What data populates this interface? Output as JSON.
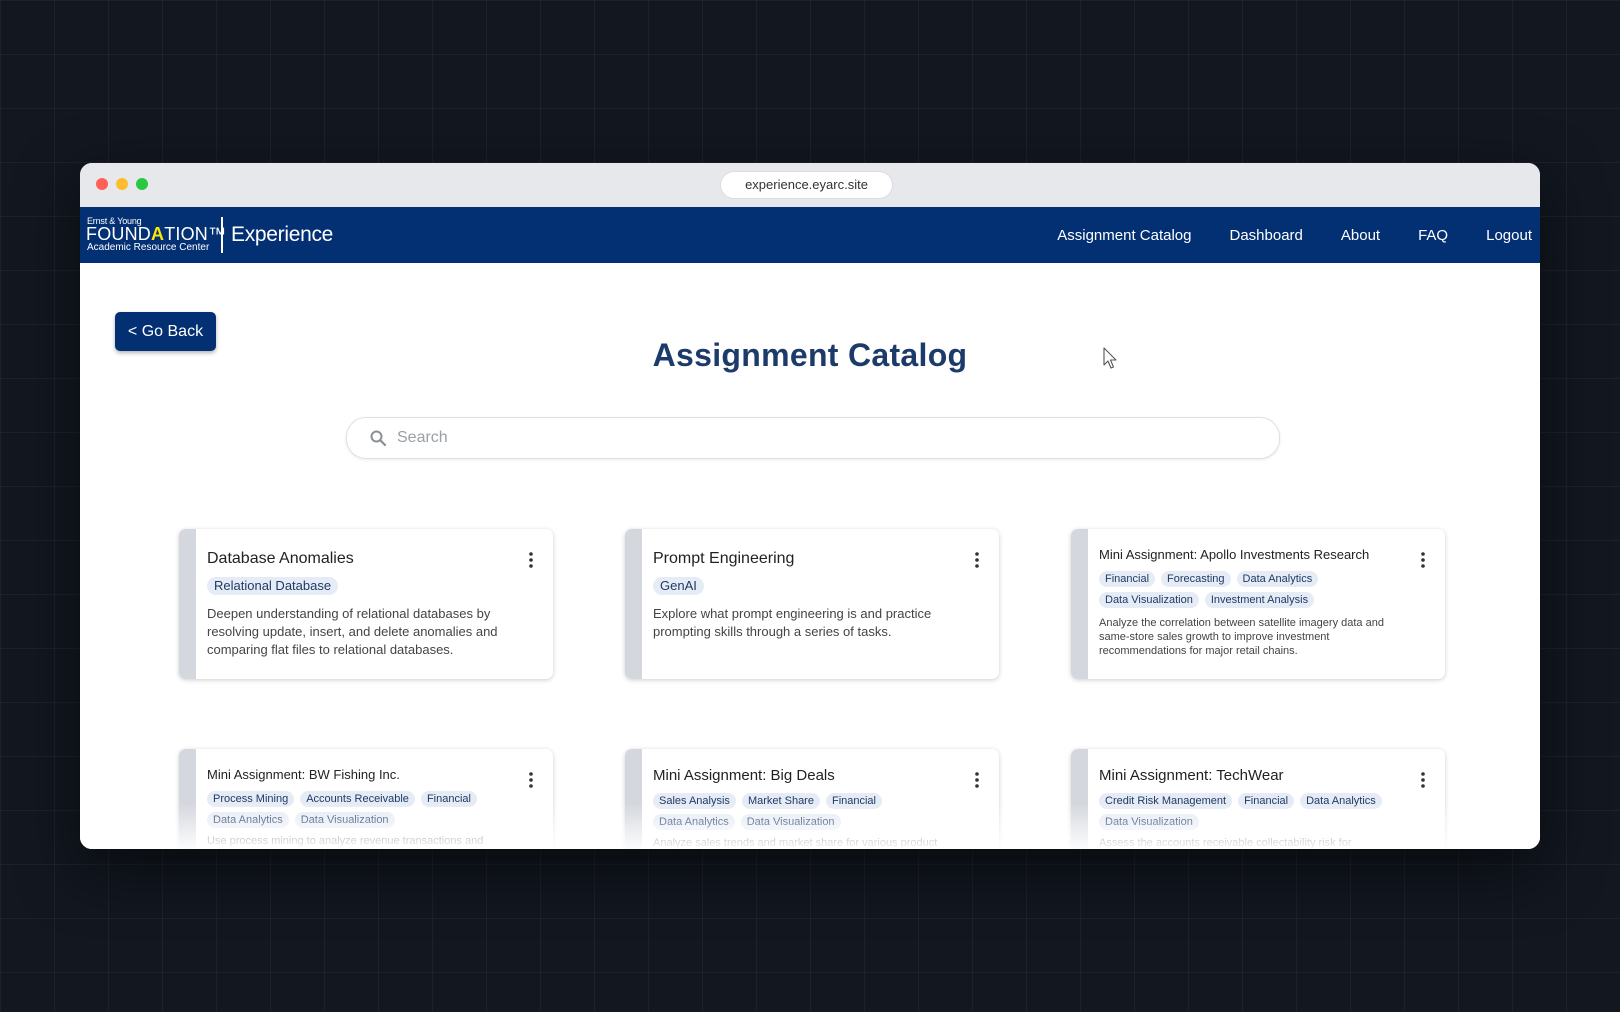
{
  "browser": {
    "url": "experience.eyarc.site"
  },
  "brand": {
    "logo_small": "Ernst & Young",
    "logo_found_pre": "FOUND",
    "logo_found_a": "A",
    "logo_found_post": "TION™",
    "logo_sub": "Academic Resource Center",
    "product": "Experience"
  },
  "nav": {
    "items": [
      {
        "label": "Assignment Catalog"
      },
      {
        "label": "Dashboard"
      },
      {
        "label": "About"
      },
      {
        "label": "FAQ"
      },
      {
        "label": "Logout"
      }
    ]
  },
  "actions": {
    "go_back": "< Go Back"
  },
  "page": {
    "title": "Assignment Catalog"
  },
  "search": {
    "placeholder": "Search",
    "value": ""
  },
  "icons": {
    "search": "search-icon",
    "kebab": "more-vertical-icon",
    "cursor": "mouse-pointer-icon"
  },
  "colors": {
    "nav_bg": "#033073",
    "title": "#1d3b6a",
    "tag_bg": "#e6ecf5",
    "accent_bar": "#d4d7dd"
  },
  "cards": [
    {
      "title": "Database Anomalies",
      "tags": [
        "Relational Database"
      ],
      "description": "Deepen understanding of relational databases by resolving update, insert, and delete anomalies and comparing flat files to relational databases."
    },
    {
      "title": "Prompt Engineering",
      "tags": [
        "GenAI"
      ],
      "description": "Explore what prompt engineering is and practice prompting skills through a series of tasks."
    },
    {
      "title": "Mini Assignment: Apollo Investments Research",
      "tags": [
        "Financial",
        "Forecasting",
        "Data Analytics",
        "Data Visualization",
        "Investment Analysis"
      ],
      "description": "Analyze the correlation between satellite imagery data and same-store sales growth to improve investment recommendations for major retail chains."
    },
    {
      "title": "Mini Assignment: BW Fishing Inc.",
      "tags": [
        "Process Mining",
        "Accounts Receivable",
        "Financial",
        "Data Analytics",
        "Data Visualization"
      ],
      "description": "Use process mining to analyze revenue transactions and"
    },
    {
      "title": "Mini Assignment: Big Deals",
      "tags": [
        "Sales Analysis",
        "Market Share",
        "Financial",
        "Data Analytics",
        "Data Visualization"
      ],
      "description": "Analyze sales trends and market share for various product"
    },
    {
      "title": "Mini Assignment: TechWear",
      "tags": [
        "Credit Risk Management",
        "Financial",
        "Data Analytics",
        "Data Visualization"
      ],
      "description": "Assess the accounts receivable collectability risk for TechWear"
    }
  ]
}
